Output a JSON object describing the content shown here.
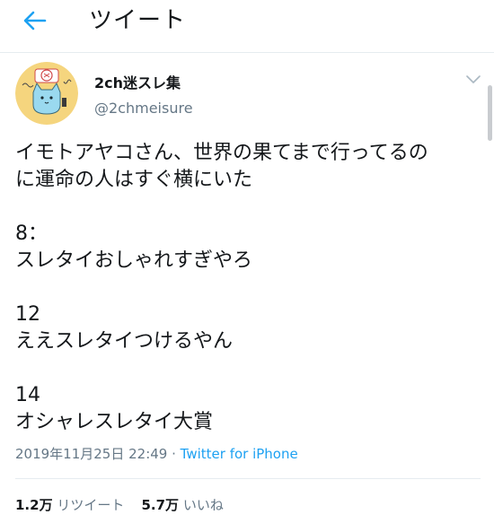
{
  "header": {
    "title": "ツイート"
  },
  "author": {
    "display_name": "2ch迷スレ集",
    "handle": "@2chmeisure"
  },
  "tweet": {
    "lines": [
      "イモトアヤコさん、世界の果てまで行ってるの",
      "に運命の人はすぐ横にいた",
      "",
      "8：",
      "スレタイおしゃれすぎやろ",
      "",
      "12",
      "ええスレタイつけるやん",
      "",
      "14",
      "オシャレスレタイ大賞"
    ],
    "timestamp": "2019年11月25日 22:49",
    "separator": " · ",
    "source": "Twitter for iPhone"
  },
  "stats": {
    "retweets_count": "1.2万",
    "retweets_label": "リツイート",
    "likes_count": "5.7万",
    "likes_label": "いいね"
  },
  "colors": {
    "accent": "#1da1f2",
    "text": "#14171a",
    "secondary": "#657786",
    "avatar_bg": "#f5d57e"
  },
  "icons": {
    "back": "arrow-left-icon",
    "caret": "chevron-down-icon"
  }
}
